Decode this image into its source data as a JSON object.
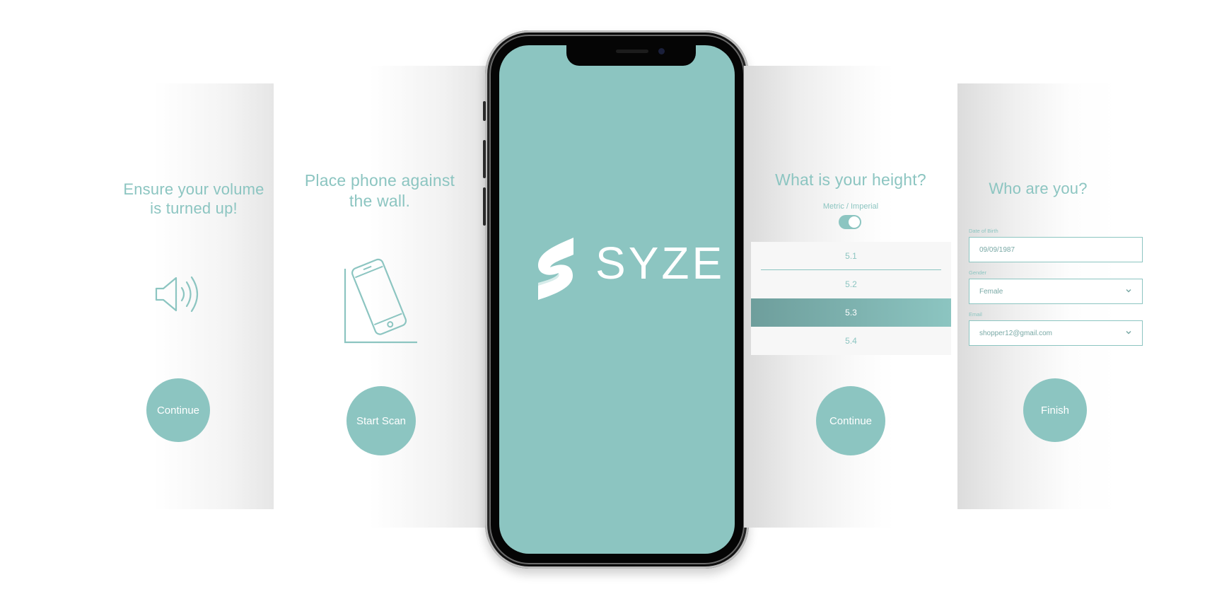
{
  "screens": {
    "volume": {
      "title_line1": "Ensure your volume",
      "title_line2": "is turned up!",
      "icon": "speaker-icon",
      "button_label": "Continue"
    },
    "placement": {
      "title_line1": "Place phone against",
      "title_line2": "the wall.",
      "icon": "phone-against-wall-icon",
      "button_label": "Start Scan"
    },
    "splash": {
      "brand": "SYZE",
      "logo": "syze-logo-icon"
    },
    "height": {
      "title": "What is your height?",
      "unit_toggle_label": "Metric / Imperial",
      "unit_toggle_on": true,
      "options": [
        "5.1",
        "5.2",
        "5.3",
        "5.4"
      ],
      "selected": "5.3",
      "button_label": "Continue"
    },
    "profile": {
      "title": "Who are you?",
      "dob_label": "Date of Birth",
      "dob_value": "09/09/1987",
      "gender_label": "Gender",
      "gender_value": "Female",
      "email_label": "Email",
      "email_value": "shopper12@gmail.com",
      "button_label": "Finish"
    }
  },
  "colors": {
    "accent": "#8cc5c1",
    "background": "#ffffff",
    "phone_frame": "#000000"
  }
}
